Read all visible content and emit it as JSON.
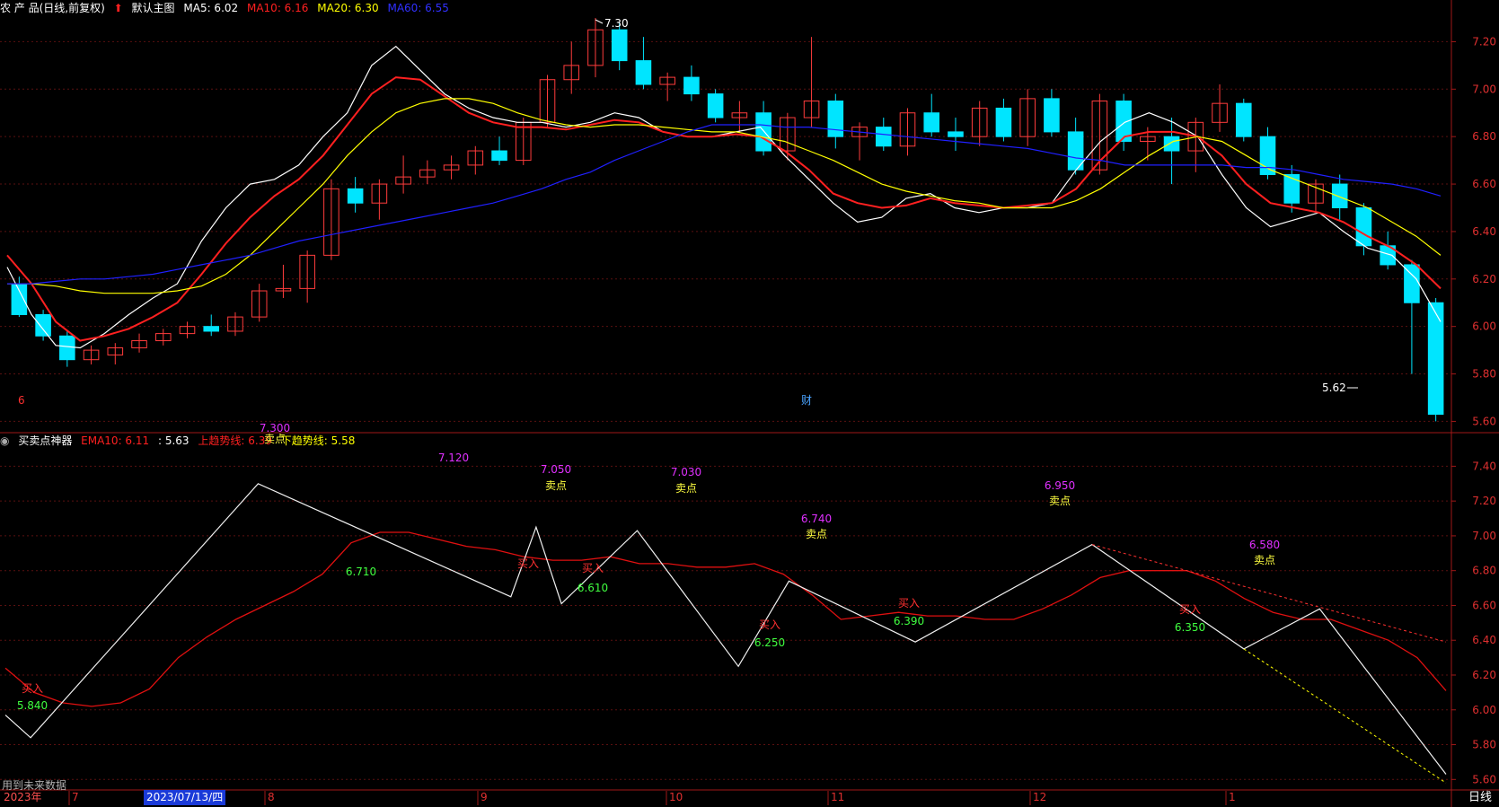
{
  "header": {
    "stock_name": "农 产 品(日线,前复权)",
    "main_chart_label": "默认主图",
    "ma5": "MA5: 6.02",
    "ma10": "MA10: 6.16",
    "ma20": "MA20: 6.30",
    "ma60": "MA60: 6.55",
    "ma5_color": "#ffffff",
    "ma10_color": "#ff2020",
    "ma20_color": "#ffff00",
    "ma60_color": "#2020ff"
  },
  "indicator_header": {
    "name": "买卖点神器",
    "ema10": "EMA10: 6.11",
    "value": ": 5.63",
    "up_trend": "上趋势线: 6.39",
    "down_trend": "下趋势线: 5.58"
  },
  "markers": {
    "finance_tag": "财",
    "left_tag": "6",
    "high_label": "7.30",
    "low_label": "5.62"
  },
  "x_axis": {
    "labels": [
      "2023年",
      "7",
      "2023/07/13/四",
      "8",
      "9",
      "10",
      "11",
      "12",
      "1"
    ],
    "period": "日线",
    "future_note": "用到未来数据"
  },
  "chart_data": [
    {
      "type": "candlestick",
      "title": "农 产 品(日线,前复权)",
      "y_ticks": [
        5.6,
        5.8,
        6.0,
        6.2,
        6.4,
        6.6,
        6.8,
        7.0,
        7.2
      ],
      "ylim": [
        5.56,
        7.3
      ],
      "x_ticks": [
        "7",
        "8",
        "9",
        "10",
        "11",
        "12",
        "1"
      ],
      "series": [
        {
          "name": "MA5",
          "values": [
            6.25,
            6.05,
            5.92,
            5.91,
            5.97,
            6.05,
            6.12,
            6.18,
            6.36,
            6.5,
            6.6,
            6.62,
            6.68,
            6.8,
            6.9,
            7.1,
            7.18,
            7.08,
            6.98,
            6.92,
            6.88,
            6.86,
            6.86,
            6.84,
            6.86,
            6.9,
            6.88,
            6.82,
            6.8,
            6.8,
            6.82,
            6.84,
            6.72,
            6.62,
            6.52,
            6.44,
            6.46,
            6.54,
            6.56,
            6.5,
            6.48,
            6.5,
            6.5,
            6.52,
            6.66,
            6.78,
            6.86,
            6.9,
            6.86,
            6.8,
            6.64,
            6.5,
            6.42,
            6.45,
            6.48,
            6.4,
            6.33,
            6.3,
            6.2,
            6.02
          ]
        },
        {
          "name": "MA10",
          "values": [
            6.3,
            6.18,
            6.02,
            5.94,
            5.96,
            5.99,
            6.04,
            6.1,
            6.22,
            6.35,
            6.46,
            6.55,
            6.62,
            6.72,
            6.85,
            6.98,
            7.05,
            7.04,
            6.97,
            6.9,
            6.86,
            6.84,
            6.84,
            6.83,
            6.85,
            6.87,
            6.86,
            6.82,
            6.8,
            6.8,
            6.81,
            6.8,
            6.74,
            6.66,
            6.56,
            6.52,
            6.5,
            6.51,
            6.54,
            6.52,
            6.51,
            6.5,
            6.51,
            6.52,
            6.58,
            6.7,
            6.8,
            6.82,
            6.82,
            6.8,
            6.72,
            6.6,
            6.52,
            6.5,
            6.48,
            6.44,
            6.38,
            6.33,
            6.26,
            6.16
          ]
        },
        {
          "name": "MA20",
          "values": [
            6.18,
            6.18,
            6.17,
            6.15,
            6.14,
            6.14,
            6.14,
            6.15,
            6.17,
            6.22,
            6.3,
            6.4,
            6.5,
            6.6,
            6.72,
            6.82,
            6.9,
            6.94,
            6.96,
            6.96,
            6.94,
            6.9,
            6.87,
            6.85,
            6.84,
            6.85,
            6.85,
            6.84,
            6.83,
            6.82,
            6.82,
            6.8,
            6.78,
            6.74,
            6.7,
            6.65,
            6.6,
            6.57,
            6.55,
            6.53,
            6.52,
            6.5,
            6.5,
            6.5,
            6.53,
            6.58,
            6.65,
            6.72,
            6.78,
            6.8,
            6.78,
            6.72,
            6.66,
            6.62,
            6.58,
            6.54,
            6.5,
            6.44,
            6.38,
            6.3
          ]
        },
        {
          "name": "MA60",
          "values": [
            6.18,
            6.18,
            6.19,
            6.2,
            6.2,
            6.21,
            6.22,
            6.24,
            6.26,
            6.28,
            6.3,
            6.33,
            6.36,
            6.38,
            6.4,
            6.42,
            6.44,
            6.46,
            6.48,
            6.5,
            6.52,
            6.55,
            6.58,
            6.62,
            6.65,
            6.7,
            6.74,
            6.78,
            6.82,
            6.85,
            6.85,
            6.85,
            6.84,
            6.84,
            6.83,
            6.82,
            6.81,
            6.8,
            6.79,
            6.78,
            6.77,
            6.76,
            6.75,
            6.73,
            6.71,
            6.7,
            6.68,
            6.68,
            6.68,
            6.68,
            6.68,
            6.67,
            6.67,
            6.66,
            6.64,
            6.62,
            6.61,
            6.6,
            6.58,
            6.55
          ]
        }
      ],
      "candles": [
        [
          6.18,
          6.21,
          6.04,
          6.05
        ],
        [
          6.05,
          6.07,
          5.94,
          5.96
        ],
        [
          5.96,
          5.98,
          5.83,
          5.86
        ],
        [
          5.86,
          5.92,
          5.84,
          5.9
        ],
        [
          5.88,
          5.93,
          5.84,
          5.91
        ],
        [
          5.91,
          5.97,
          5.89,
          5.94
        ],
        [
          5.94,
          5.99,
          5.92,
          5.97
        ],
        [
          5.97,
          6.02,
          5.95,
          6.0
        ],
        [
          6.0,
          6.05,
          5.96,
          5.98
        ],
        [
          5.98,
          6.06,
          5.96,
          6.04
        ],
        [
          6.04,
          6.18,
          6.02,
          6.15
        ],
        [
          6.15,
          6.26,
          6.12,
          6.16
        ],
        [
          6.16,
          6.32,
          6.1,
          6.3
        ],
        [
          6.3,
          6.62,
          6.28,
          6.58
        ],
        [
          6.58,
          6.63,
          6.48,
          6.52
        ],
        [
          6.52,
          6.62,
          6.45,
          6.6
        ],
        [
          6.6,
          6.72,
          6.56,
          6.63
        ],
        [
          6.63,
          6.7,
          6.6,
          6.66
        ],
        [
          6.66,
          6.72,
          6.62,
          6.68
        ],
        [
          6.68,
          6.76,
          6.64,
          6.74
        ],
        [
          6.74,
          6.8,
          6.68,
          6.7
        ],
        [
          6.7,
          6.88,
          6.68,
          6.86
        ],
        [
          6.86,
          7.06,
          6.84,
          7.04
        ],
        [
          7.04,
          7.2,
          6.98,
          7.1
        ],
        [
          7.1,
          7.3,
          7.05,
          7.25
        ],
        [
          7.25,
          7.28,
          7.08,
          7.12
        ],
        [
          7.12,
          7.22,
          7.0,
          7.02
        ],
        [
          7.02,
          7.07,
          6.95,
          7.05
        ],
        [
          7.05,
          7.1,
          6.95,
          6.98
        ],
        [
          6.98,
          7.0,
          6.86,
          6.88
        ],
        [
          6.88,
          6.95,
          6.82,
          6.9
        ],
        [
          6.9,
          6.95,
          6.72,
          6.74
        ],
        [
          6.74,
          6.9,
          6.7,
          6.88
        ],
        [
          6.88,
          7.22,
          6.84,
          6.95
        ],
        [
          6.95,
          6.98,
          6.75,
          6.8
        ],
        [
          6.8,
          6.86,
          6.7,
          6.84
        ],
        [
          6.84,
          6.88,
          6.74,
          6.76
        ],
        [
          6.76,
          6.92,
          6.72,
          6.9
        ],
        [
          6.9,
          6.98,
          6.8,
          6.82
        ],
        [
          6.82,
          6.88,
          6.74,
          6.8
        ],
        [
          6.8,
          6.95,
          6.76,
          6.92
        ],
        [
          6.92,
          6.96,
          6.78,
          6.8
        ],
        [
          6.8,
          7.0,
          6.76,
          6.96
        ],
        [
          6.96,
          7.0,
          6.8,
          6.82
        ],
        [
          6.82,
          6.88,
          6.64,
          6.66
        ],
        [
          6.66,
          6.98,
          6.64,
          6.95
        ],
        [
          6.95,
          6.98,
          6.74,
          6.78
        ],
        [
          6.78,
          6.84,
          6.7,
          6.8
        ],
        [
          6.8,
          6.88,
          6.6,
          6.74
        ],
        [
          6.74,
          6.88,
          6.65,
          6.86
        ],
        [
          6.86,
          7.02,
          6.82,
          6.94
        ],
        [
          6.94,
          6.96,
          6.78,
          6.8
        ],
        [
          6.8,
          6.84,
          6.62,
          6.64
        ],
        [
          6.64,
          6.68,
          6.48,
          6.52
        ],
        [
          6.52,
          6.62,
          6.48,
          6.6
        ],
        [
          6.6,
          6.64,
          6.45,
          6.5
        ],
        [
          6.5,
          6.52,
          6.3,
          6.34
        ],
        [
          6.34,
          6.4,
          6.24,
          6.26
        ],
        [
          6.26,
          6.28,
          5.8,
          6.1
        ],
        [
          6.1,
          6.12,
          5.6,
          5.63
        ]
      ]
    },
    {
      "type": "line",
      "title": "买卖点神器",
      "y_ticks": [
        5.6,
        5.8,
        6.0,
        6.2,
        6.4,
        6.6,
        6.8,
        7.0,
        7.2,
        7.4
      ],
      "ylim": [
        5.55,
        7.5
      ],
      "series": [
        {
          "name": "EMA10",
          "values": [
            6.24,
            6.1,
            6.04,
            6.02,
            6.04,
            6.12,
            6.3,
            6.42,
            6.52,
            6.6,
            6.68,
            6.78,
            6.96,
            7.02,
            7.02,
            6.98,
            6.94,
            6.92,
            6.88,
            6.86,
            6.86,
            6.88,
            6.84,
            6.84,
            6.82,
            6.82,
            6.84,
            6.78,
            6.66,
            6.52,
            6.54,
            6.56,
            6.54,
            6.54,
            6.52,
            6.52,
            6.58,
            6.66,
            6.76,
            6.8,
            6.8,
            6.8,
            6.74,
            6.64,
            6.56,
            6.52,
            6.52,
            6.46,
            6.4,
            6.3,
            6.11
          ]
        }
      ],
      "zigzag_points": [
        [
          0,
          5.97
        ],
        [
          1,
          5.84
        ],
        [
          10,
          7.3
        ],
        [
          20,
          6.65
        ],
        [
          21,
          7.05
        ],
        [
          22,
          6.61
        ],
        [
          25,
          7.03
        ],
        [
          29,
          6.25
        ],
        [
          31,
          6.74
        ],
        [
          36,
          6.39
        ],
        [
          43,
          6.95
        ],
        [
          49,
          6.35
        ],
        [
          52,
          6.58
        ],
        [
          57,
          5.63
        ]
      ],
      "trend_lines": [
        {
          "name": "上趋势线",
          "value": 6.39
        },
        {
          "name": "下趋势线",
          "value": 5.58
        }
      ],
      "annotations": [
        {
          "text": "买入",
          "value": "5.840",
          "type": "buy"
        },
        {
          "text": "卖点",
          "value": "7.300",
          "type": "sell"
        },
        {
          "text": "",
          "value": "7.120",
          "type": "peak"
        },
        {
          "text": "",
          "value": "6.710",
          "type": "low"
        },
        {
          "text": "买入",
          "value": "",
          "type": "buy"
        },
        {
          "text": "卖点",
          "value": "7.050",
          "type": "sell"
        },
        {
          "text": "买入",
          "value": "6.610",
          "type": "buy"
        },
        {
          "text": "卖点",
          "value": "7.030",
          "type": "sell"
        },
        {
          "text": "买入",
          "value": "6.250",
          "type": "buy"
        },
        {
          "text": "卖点",
          "value": "6.740",
          "type": "sell"
        },
        {
          "text": "买入",
          "value": "6.390",
          "type": "buy"
        },
        {
          "text": "卖点",
          "value": "6.950",
          "type": "sell"
        },
        {
          "text": "买入",
          "value": "6.350",
          "type": "buy"
        },
        {
          "text": "卖点",
          "value": "6.580",
          "type": "sell"
        }
      ]
    }
  ]
}
